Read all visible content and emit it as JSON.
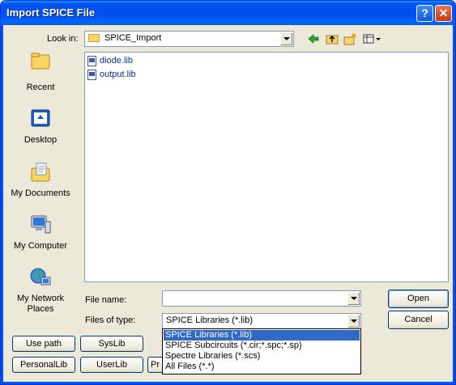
{
  "window": {
    "title": "Import SPICE File"
  },
  "title_buttons": {
    "help": "?",
    "close": "✕"
  },
  "look_in": {
    "label": "Look in:",
    "value": "SPICE_Import"
  },
  "places": [
    {
      "label": "Recent"
    },
    {
      "label": "Desktop"
    },
    {
      "label": "My Documents"
    },
    {
      "label": "My Computer"
    },
    {
      "label": "My Network",
      "label2": "Places"
    }
  ],
  "files": [
    {
      "name": "diode.lib"
    },
    {
      "name": "output.lib"
    }
  ],
  "file_name": {
    "label": "File name:",
    "value": ""
  },
  "file_type": {
    "label": "Files of type:",
    "value": "SPICE Libraries (*.lib)"
  },
  "buttons": {
    "open": "Open",
    "cancel": "Cancel",
    "use_path": "Use path",
    "syslib": "SysLib",
    "personallib": "PersonalLib",
    "userlib": "UserLib",
    "partial": "Pr"
  },
  "type_options": [
    "SPICE Libraries (*.lib)",
    "SPICE Subcircuits (*.cir;*.spc;*.sp)",
    "Spectre Libraries (*.scs)",
    "All Files (*.*)"
  ],
  "colors": {
    "title_bar": "#0053ee",
    "selection": "#316ac5",
    "dialog_bg": "#ece9d8"
  }
}
